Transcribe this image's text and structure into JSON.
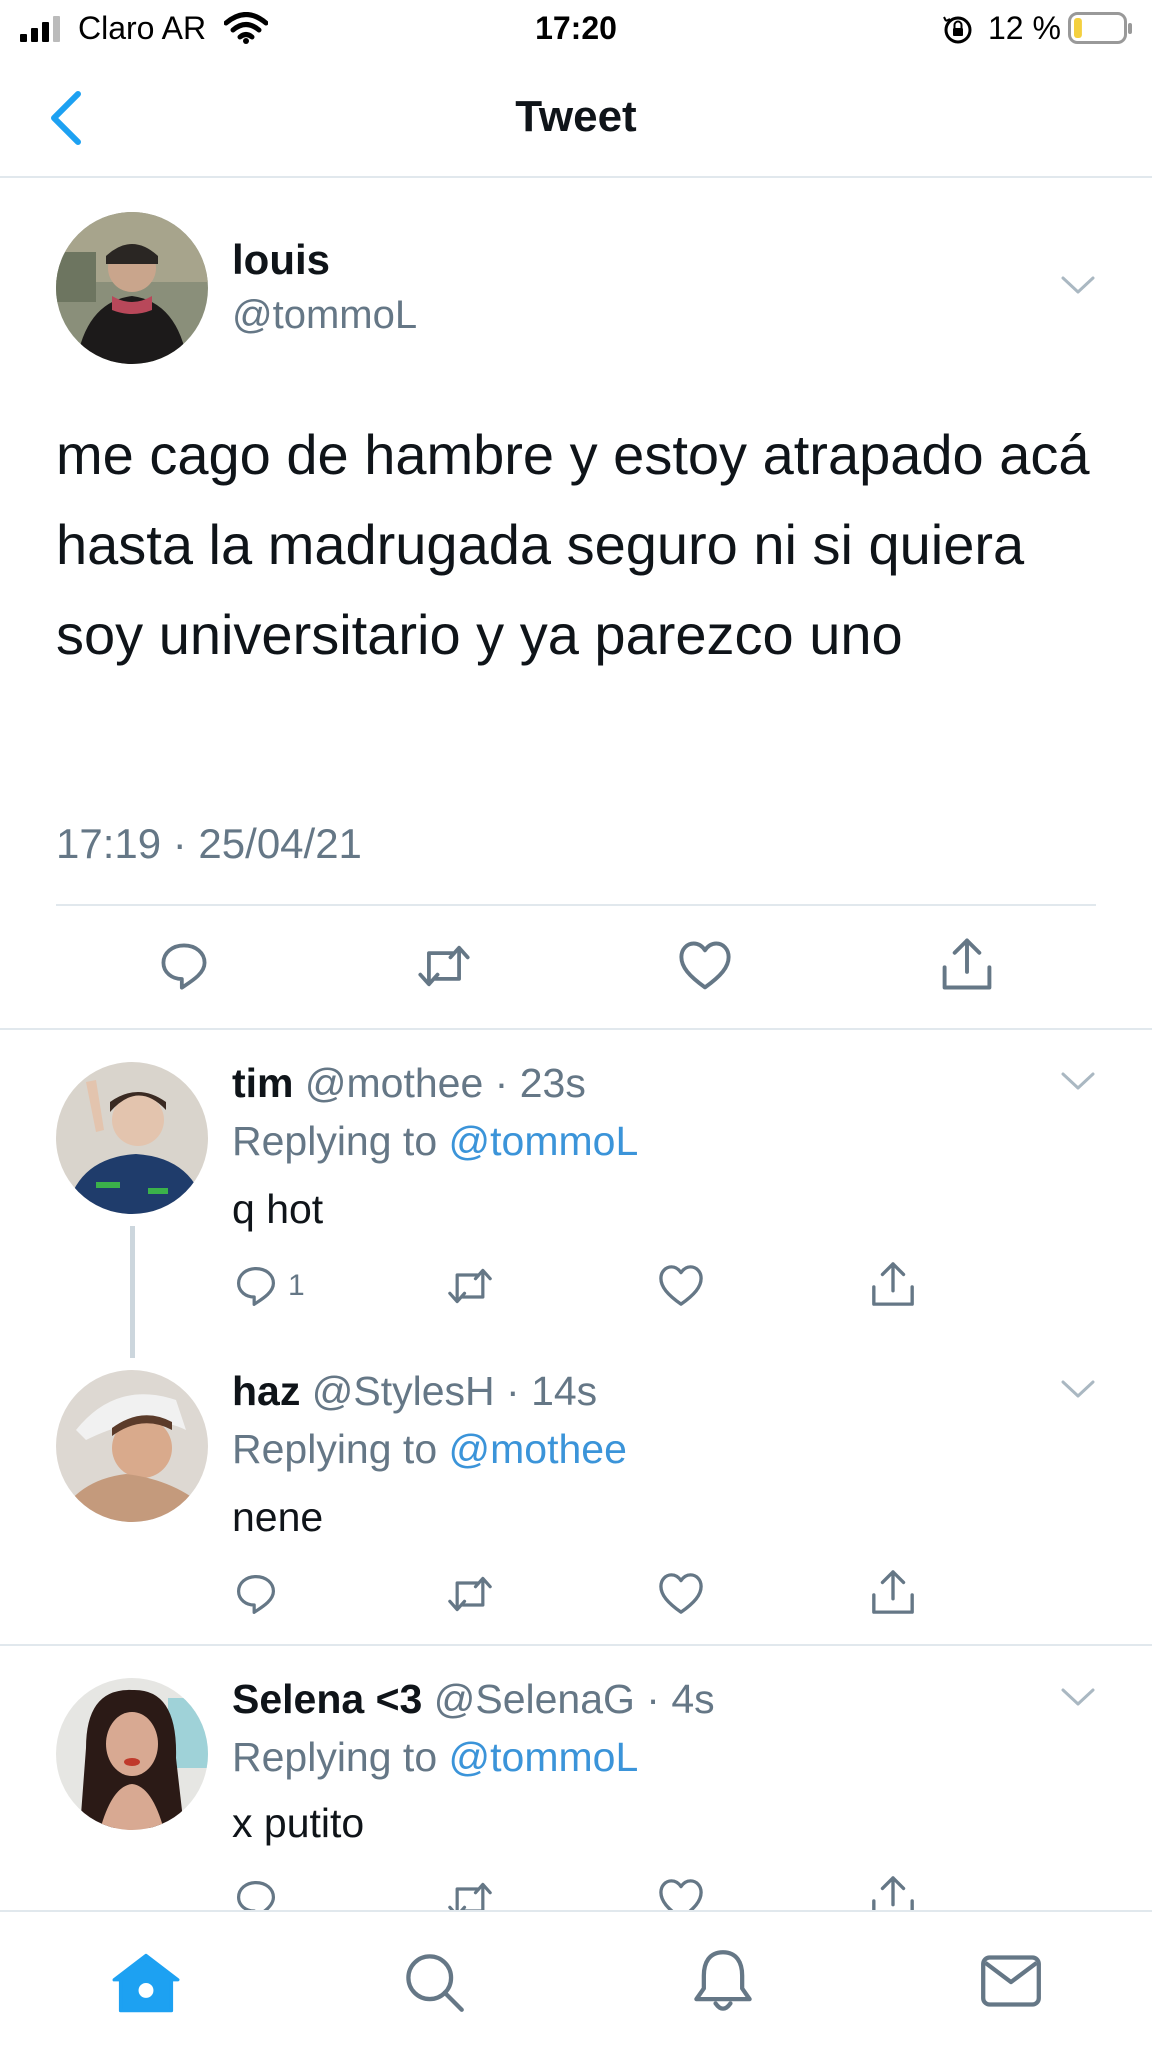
{
  "status_bar": {
    "carrier": "Claro AR",
    "time": "17:20",
    "battery": "12 %",
    "battery_level": 0.12,
    "battery_color": "#f4d03f"
  },
  "nav": {
    "title": "Tweet",
    "back_icon": "chevron-left-icon"
  },
  "main_tweet": {
    "name": "louis",
    "handle": "@tommoL",
    "text": "me cago de hambre y estoy atrapado acá hasta la madrugada seguro ni si quiera soy universitario y ya parezco uno",
    "timestamp": "17:19 · 25/04/21",
    "actions": [
      "reply-icon",
      "retweet-icon",
      "like-icon",
      "share-icon"
    ]
  },
  "replies": [
    {
      "name": "tim",
      "handle": "@mothee · 23s",
      "replying_prefix": "Replying to ",
      "replying_to": "@tommoL",
      "text": "q hot",
      "reply_count": "1"
    },
    {
      "name": "haz",
      "handle": "@StylesH · 14s",
      "replying_prefix": "Replying to ",
      "replying_to": "@mothee",
      "text": "nene",
      "reply_count": ""
    },
    {
      "name": "Selena <3",
      "handle": "@SelenaG · 4s",
      "replying_prefix": "Replying to ",
      "replying_to": "@tommoL",
      "text": "x putito",
      "reply_count": ""
    }
  ],
  "tab_bar": {
    "items": [
      "home-icon",
      "search-icon",
      "notifications-icon",
      "messages-icon"
    ],
    "active": "home-icon"
  },
  "colors": {
    "accent": "#1da1f2",
    "link": "#3b94d9",
    "secondary_text": "#657786",
    "icon_gray": "#657786",
    "divider": "#e1e8ed"
  }
}
